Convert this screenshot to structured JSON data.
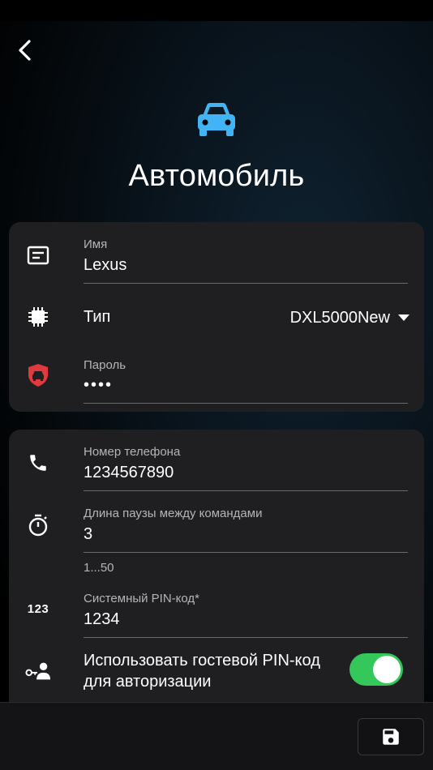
{
  "header": {
    "back_icon": "chevron-left-icon",
    "hero_icon": "car-icon",
    "hero_icon_color": "#42b4f5",
    "title": "Автомобиль"
  },
  "card_main": {
    "name": {
      "icon": "notes-icon",
      "label": "Имя",
      "value": "Lexus"
    },
    "type": {
      "icon": "chip-icon",
      "label": "Тип",
      "value": "DXL5000New",
      "dropdown_icon": "caret-down-icon"
    },
    "password": {
      "icon": "car-shield-icon",
      "icon_color": "#e0393e",
      "label": "Пароль",
      "value": "••••"
    }
  },
  "card_settings": {
    "phone": {
      "icon": "phone-icon",
      "label": "Номер телефона",
      "value": "1234567890"
    },
    "pause": {
      "icon": "timer-icon",
      "label": "Длина паузы между командами",
      "value": "3",
      "helper": "1...50"
    },
    "pin": {
      "icon": "numbers-icon",
      "icon_text": "123",
      "label": "Системный PIN-код*",
      "value": "1234"
    },
    "guest_pin": {
      "icon": "key-person-icon",
      "label": "Использовать гостевой PIN-код для авторизации",
      "enabled": true,
      "toggle_color": "#34c759"
    }
  },
  "footer": {
    "save_icon": "save-icon"
  }
}
